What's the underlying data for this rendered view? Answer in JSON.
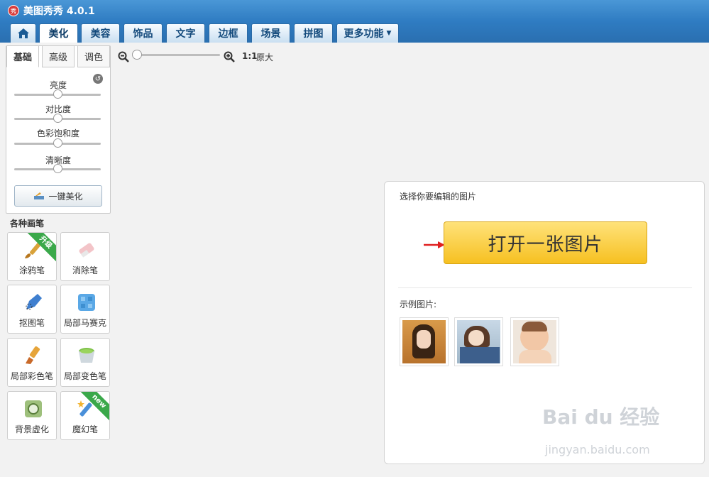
{
  "app": {
    "title": "美图秀秀 4.0.1",
    "logo_text": "秀"
  },
  "tabs": [
    {
      "label": "美化",
      "active": true
    },
    {
      "label": "美容"
    },
    {
      "label": "饰品"
    },
    {
      "label": "文字"
    },
    {
      "label": "边框"
    },
    {
      "label": "场景"
    },
    {
      "label": "拼图"
    },
    {
      "label": "更多功能"
    }
  ],
  "adjust": {
    "subtabs": [
      "基础",
      "高级",
      "调色"
    ],
    "sliders": [
      {
        "label": "亮度",
        "value": 0.5
      },
      {
        "label": "对比度",
        "value": 0.5
      },
      {
        "label": "色彩饱和度",
        "value": 0.5
      },
      {
        "label": "清晰度",
        "value": 0.5
      }
    ],
    "one_click_label": "一键美化"
  },
  "brushes": {
    "heading": "各种画笔",
    "items": [
      {
        "label": "涂鸦笔",
        "badge": "升级"
      },
      {
        "label": "消除笔"
      },
      {
        "label": "抠图笔"
      },
      {
        "label": "局部马赛克"
      },
      {
        "label": "局部彩色笔"
      },
      {
        "label": "局部变色笔"
      },
      {
        "label": "背景虚化"
      },
      {
        "label": "魔幻笔",
        "badge": "new"
      }
    ]
  },
  "zoom": {
    "ratio": "1:1",
    "original_label": "原大",
    "level": 0.0
  },
  "open_panel": {
    "title": "选择你要编辑的图片",
    "open_button": "打开一张图片",
    "samples_label": "示例图片:"
  },
  "watermark": {
    "main": "Bai du 经验",
    "sub": "jingyan.baidu.com"
  },
  "colors": {
    "accent": "#2f7cc2",
    "button": "#f6c021",
    "badge": "#3aa84a"
  }
}
